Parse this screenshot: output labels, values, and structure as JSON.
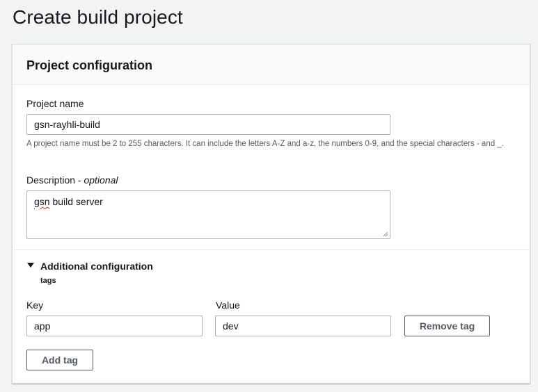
{
  "page": {
    "title": "Create build project"
  },
  "panel": {
    "title": "Project configuration",
    "project_name": {
      "label": "Project name",
      "value": "gsn-rayhli-build",
      "hint": "A project name must be 2 to 255 characters. It can include the letters A-Z and a-z, the numbers 0-9, and the special characters - and _."
    },
    "description": {
      "label": "Description - ",
      "label_optional": "optional",
      "value_misspelled": "gsn",
      "value_rest": " build server"
    },
    "additional": {
      "title": "Additional configuration",
      "subtitle": "tags",
      "key_label": "Key",
      "value_label": "Value",
      "tags": [
        {
          "key": "app",
          "value": "dev"
        }
      ],
      "remove_tag_label": "Remove tag",
      "add_tag_label": "Add tag"
    }
  },
  "colors": {
    "page_bg": "#f2f3f3",
    "panel_header_bg": "#fafafa",
    "border": "#aab7b8",
    "button_text": "#545b64",
    "spelling_underline": "#d13212"
  },
  "icons": {
    "expand": "caret-down-icon",
    "textarea_resize": "resize-grip-icon"
  }
}
